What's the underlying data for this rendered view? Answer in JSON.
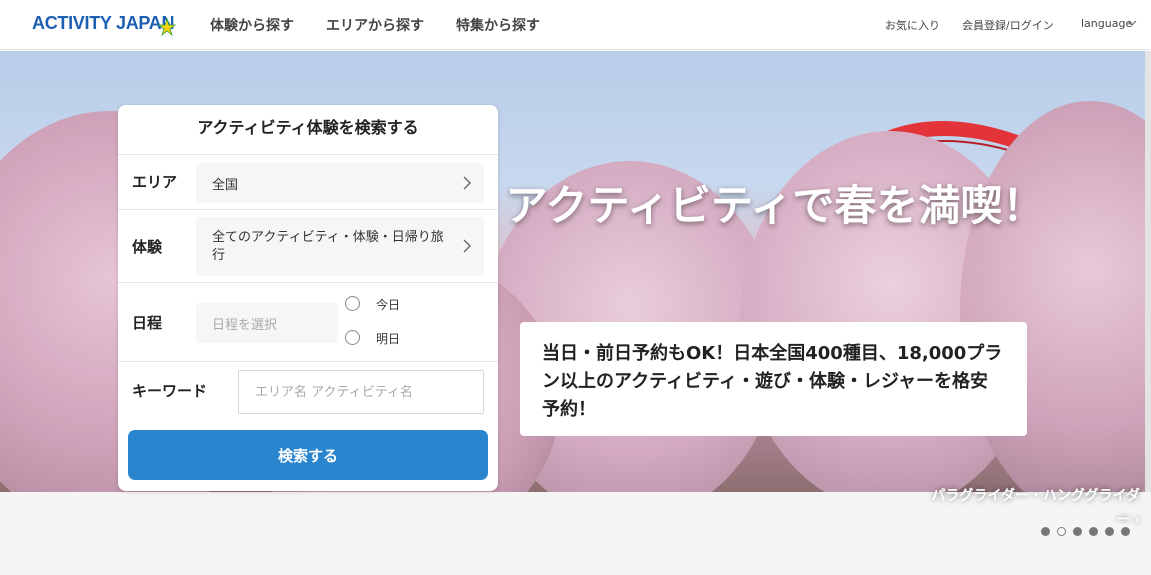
{
  "header": {
    "logo": "ACTIVITY JAPAN",
    "nav": [
      "体験から探す",
      "エリアから探す",
      "特集から探す"
    ],
    "favorites": "お気に入り",
    "login": "会員登録/ログイン",
    "language": "language"
  },
  "search": {
    "title": "アクティビティ体験を検索する",
    "area_label": "エリア",
    "area_value": "全国",
    "activity_label": "体験",
    "activity_value": "全てのアクティビティ・体験・日帰り旅行",
    "date_label": "日程",
    "date_placeholder": "日程を選択",
    "today": "今日",
    "tomorrow": "明日",
    "keyword_label": "キーワード",
    "keyword_placeholder": "エリア名 アクティビティ名",
    "button": "検索する"
  },
  "hero": {
    "title": "アクティビティで春を満喫！",
    "subtitle": "当日・前日予約もOK！日本全国400種目、18,000プラン以上のアクティビティ・遊び・体験・レジャーを格安予約！",
    "caption": "パラグライダー・ハンググライダー",
    "slide_count": 6,
    "active_slide": 2
  },
  "icons": {
    "chevron": "chevron-right-icon",
    "lang_chevron": "chevron-down-icon"
  },
  "colors": {
    "brand": "#1d5fb3",
    "accent": "#2a85cf"
  }
}
